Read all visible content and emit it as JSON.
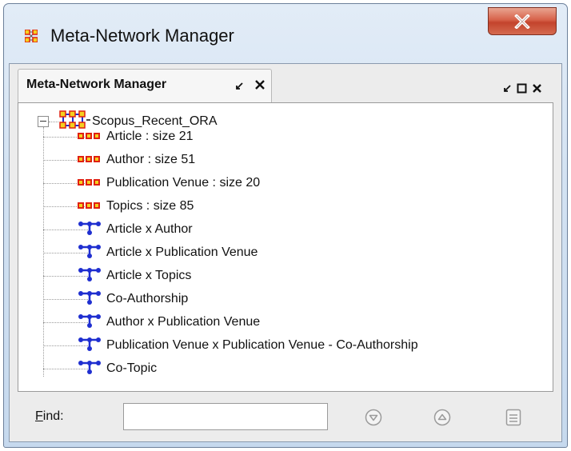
{
  "window": {
    "title": "Meta-Network Manager"
  },
  "panel": {
    "tab_label": "Meta-Network Manager"
  },
  "tree": {
    "root": {
      "label": "Scopus_Recent_ORA",
      "icon": "meta-network-icon"
    },
    "items": [
      {
        "label": "Article : size 21",
        "icon": "node-class-icon"
      },
      {
        "label": "Author : size 51",
        "icon": "node-class-icon"
      },
      {
        "label": "Publication Venue : size 20",
        "icon": "node-class-icon"
      },
      {
        "label": "Topics : size 85",
        "icon": "node-class-icon"
      },
      {
        "label": "Article x Author",
        "icon": "network-icon"
      },
      {
        "label": "Article x Publication Venue",
        "icon": "network-icon"
      },
      {
        "label": "Article x Topics",
        "icon": "network-icon"
      },
      {
        "label": "Co-Authorship",
        "icon": "network-icon"
      },
      {
        "label": "Author x Publication Venue",
        "icon": "network-icon"
      },
      {
        "label": "Publication Venue x Publication Venue - Co-Authorship",
        "icon": "network-icon"
      },
      {
        "label": "Co-Topic",
        "icon": "network-icon"
      }
    ]
  },
  "find": {
    "label_first": "F",
    "label_rest": "ind:",
    "value": ""
  },
  "colors": {
    "node_red": "#e02010",
    "node_yellow": "#f4d020",
    "network_blue": "#1f2fd0"
  }
}
